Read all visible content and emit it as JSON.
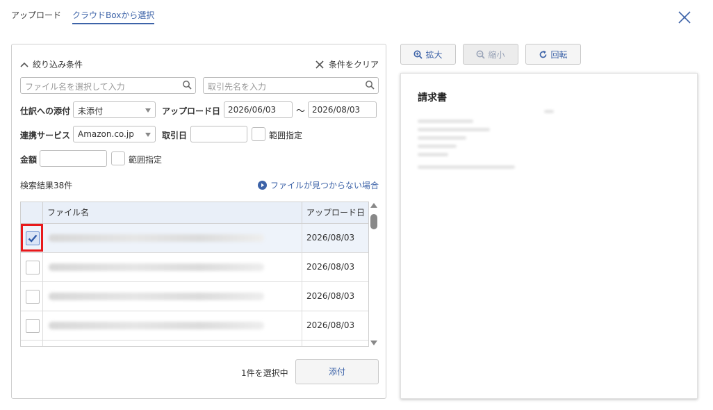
{
  "tabs": {
    "upload": "アップロード",
    "cloud_box": "クラウドBoxから選択"
  },
  "filter": {
    "toggle_label": "絞り込み条件",
    "clear_label": "条件をクリア",
    "file_name_placeholder": "ファイル名を選択して入力",
    "partner_placeholder": "取引先名を入力",
    "journal_attach_label": "仕訳への添付",
    "journal_attach_value": "未添付",
    "upload_date_label": "アップロード日",
    "upload_date_from": "2026/06/03",
    "range_sep": "〜",
    "upload_date_to": "2026/08/03",
    "service_label": "連携サービス",
    "service_value": "Amazon.co.jp",
    "transaction_date_label": "取引日",
    "transaction_date_value": "",
    "range_label": "範囲指定",
    "amount_label": "金額",
    "amount_value": "",
    "amount_range_label": "範囲指定"
  },
  "results": {
    "count_text": "検索結果38件",
    "help_link": "ファイルが見つからない場合",
    "columns": [
      "ファイル名",
      "アップロード日"
    ],
    "rows": [
      {
        "date": "2026/08/03",
        "checked": true
      },
      {
        "date": "2026/08/03",
        "checked": false
      },
      {
        "date": "2026/08/03",
        "checked": false
      },
      {
        "date": "2026/08/03",
        "checked": false
      }
    ]
  },
  "footer": {
    "selected_text": "1件を選択中",
    "attach_label": "添付"
  },
  "preview_toolbar": {
    "zoom_in": "拡大",
    "zoom_out": "縮小",
    "rotate": "回転"
  },
  "preview": {
    "doc_title": "請求書"
  },
  "colors": {
    "accent": "#3d63a8",
    "highlight": "#e8191b",
    "header_bg": "#e9eff8"
  }
}
